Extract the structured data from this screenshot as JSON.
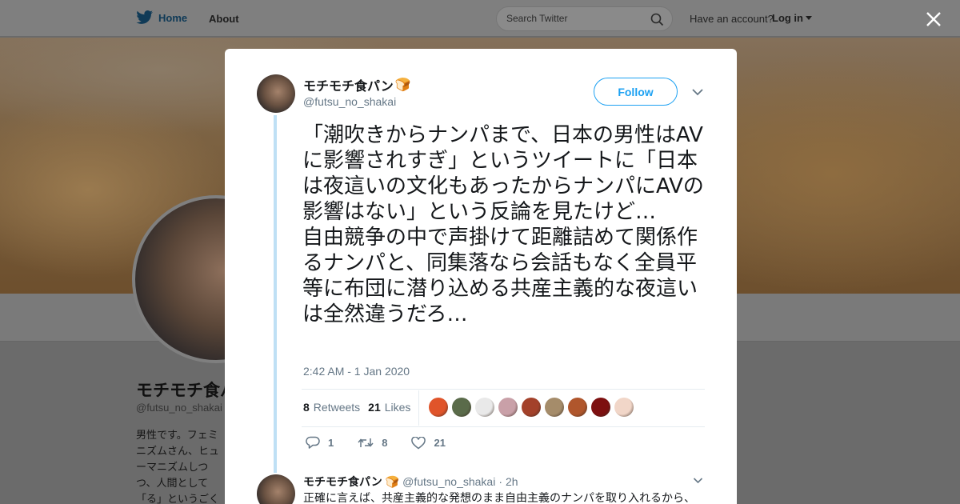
{
  "nav": {
    "home_label": "Home",
    "about_label": "About",
    "search_placeholder": "Search Twitter",
    "have_account": "Have an account?",
    "login_label": "Log in",
    "brand_color": "#1da1f2"
  },
  "profile_bg": {
    "name": "モチモチ食パン",
    "handle": "@futsu_no_shakai",
    "bio": "男性です。フェミニズムさん、ヒューマニズムしつつ、人間として「る」というごく普ます。ツイートの"
  },
  "tweet": {
    "author_name": "モチモチ食パン",
    "author_emoji": "🍞",
    "author_handle": "@futsu_no_shakai",
    "follow_label": "Follow",
    "text": "「潮吹きからナンパまで、日本の男性はAVに影響されすぎ」というツイートに「日本は夜這いの文化もあったからナンパにAVの影響はない」という反論を見たけど…\n自由競争の中で声掛けて距離詰めて関係作るナンパと、同集落なら会話もなく全員平等に布団に潜り込める共産主義的な夜這いは全然違うだろ…",
    "timestamp": "2:42 AM - 1 Jan 2020",
    "retweets_count": "8",
    "retweets_label": "Retweets",
    "likes_count": "21",
    "likes_label": "Likes",
    "reply_count": "1",
    "retweet_action_count": "8",
    "like_action_count": "21",
    "liker_colors": [
      "#e0542a",
      "#5a6b4a",
      "#e9e9e9",
      "#c9a0a8",
      "#a3412a",
      "#a58c6a",
      "#b0562c",
      "#7d1010",
      "#f1d6c8"
    ]
  },
  "reply": {
    "name": "モチモチ食パン",
    "emoji": "🍞",
    "handle": "@futsu_no_shakai",
    "dot": "·",
    "time": "2h",
    "text": "正確に言えば、共産主義的な発想のまま自由主義のナンパを取り入れるから、"
  }
}
